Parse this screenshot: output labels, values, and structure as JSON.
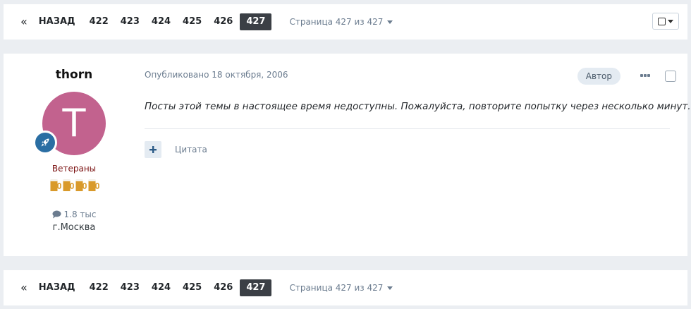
{
  "pagination": {
    "first_label": "«",
    "back_label": "НАЗАД",
    "pages": [
      "422",
      "423",
      "424",
      "425",
      "426"
    ],
    "active_page": "427",
    "page_jump_label": "Страница 427 из 427"
  },
  "post": {
    "author_name": "thorn",
    "avatar_letter": "T",
    "group": "Ветераны",
    "posts_count": "1.8 тыс",
    "location": "г.Москва",
    "date_text": "Опубликовано 18 октября, 2006",
    "author_badge": "Автор",
    "content": "Посты этой темы в настоящее время недоступны. Пожалуйста, повторите попытку через несколько минут.",
    "quote_label": "Цитата"
  },
  "colors": {
    "avatar_bg": "#c2628e",
    "rank_badge": "#2a6ea3",
    "active_page_bg": "#3b3f45",
    "group_color": "#7a1010"
  }
}
